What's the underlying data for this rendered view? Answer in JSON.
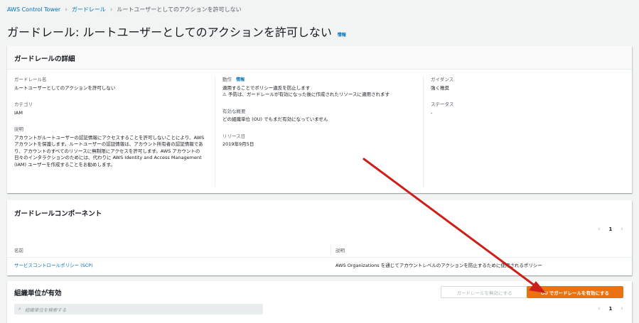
{
  "breadcrumb": {
    "items": [
      "AWS Control Tower",
      "ガードレール",
      "ルートユーザーとしてのアクションを許可しない"
    ]
  },
  "page": {
    "title": "ガードレール: ルートユーザーとしてのアクションを許可しない",
    "info_link": "情報"
  },
  "details": {
    "header": "ガードレールの詳細",
    "name_label": "ガードレール名",
    "name_value": "ルートユーザーとしてのアクションを許可しない",
    "category_label": "カテゴリ",
    "category_value": "IAM",
    "description_label": "説明",
    "description_value": "アカウントがルートユーザーの認証情報にアクセスすることを許可しないことにより、AWS アカウントを保護します。ルートユーザーの認証情報は、アカウント所有者の認証情報であり、アカウントのすべてのリソースに無制限にアクセスを許可します。AWS アカウントの日々のインタラクションのためには、代わりに AWS Identity and Access Management (IAM) ユーザーを作成することをお勧めします。",
    "behavior_label": "動作",
    "behavior_info": "情報",
    "behavior_value": "適用することでポリシー違反を防止します",
    "behavior_warning": "予防は、ガードレールが有効になった後に作成されたリソースに適用されます",
    "enabled_summary_label": "有効な概要",
    "enabled_summary_value": "どの組織単位 (OU) でもまだ有効になっていません",
    "release_label": "リリース日",
    "release_value": "2019年9月5日",
    "guidance_label": "ガイダンス",
    "guidance_value": "強く推奨",
    "status_label": "ステータス",
    "status_value": "-"
  },
  "components": {
    "header": "ガードレールコンポーネント",
    "page": "1",
    "columns": [
      "名前",
      "説明"
    ],
    "rows": [
      {
        "name": "サービスコントロールポリシー (SCP)",
        "description": "AWS Organizations を通じてアカウントレベルのアクションを防止するために使用されるポリシー"
      }
    ]
  },
  "ou": {
    "header": "組織単位が有効",
    "disable_button": "ガードレールを無効にする",
    "enable_button": "OU でガードレールを有効にする",
    "search_placeholder": "組織単位を検索する",
    "page": "1"
  },
  "colors": {
    "accent": "#0073bb",
    "primary_button": "#ec7211",
    "annotation_arrow": "#cc1f1a"
  }
}
